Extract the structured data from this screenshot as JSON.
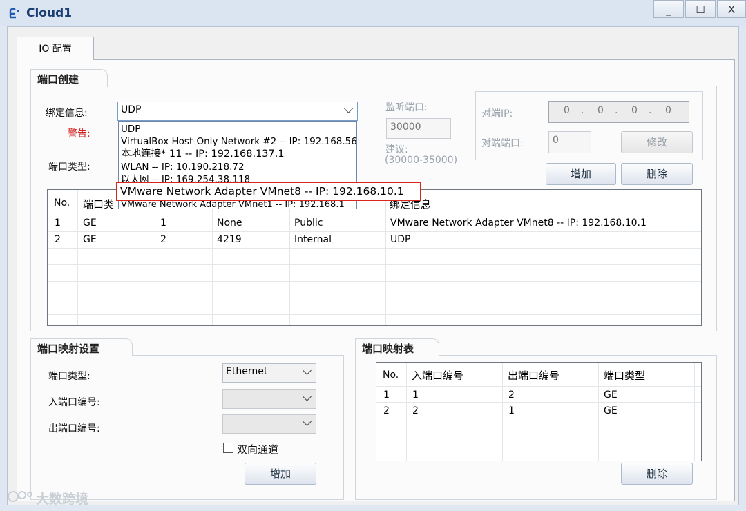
{
  "window": {
    "title": "Cloud1",
    "minimize_glyph": "_",
    "maximize_glyph": "☐",
    "close_glyph": "X"
  },
  "tab": {
    "label": "IO 配置"
  },
  "port_creation": {
    "title": "端口创建",
    "binding_label": "绑定信息:",
    "binding_value": "UDP",
    "warning_label": "警告:",
    "port_type_label": "端口类型:",
    "listen_port_label": "监听端口:",
    "listen_port_value": "30000",
    "suggest_label": "建议:",
    "suggest_range": "(30000-35000)",
    "peer_ip_label": "对端IP:",
    "peer_ip_octets": [
      "0",
      "0",
      "0",
      "0"
    ],
    "peer_port_label": "对端端口:",
    "peer_port_value": "0",
    "modify_button": "修改",
    "add_button": "增加",
    "delete_button": "删除"
  },
  "binding_dropdown": {
    "options": [
      "UDP",
      "VirtualBox Host-Only Network #2 -- IP: 192.168.56",
      "本地连接* 11 -- IP: 192.168.137.1",
      "WLAN -- IP: 10.190.218.72",
      "以太网 -- IP: 169.254.38.118",
      "VMware Network Adapter VMnet8 -- IP: 192.168.10.1",
      "VMware Network Adapter VMnet1 -- IP: 192.168.1"
    ],
    "highlighted": "VMware Network Adapter VMnet8 -- IP: 192.168.10.1"
  },
  "port_table": {
    "headers": [
      "No.",
      "端口类",
      "",
      "",
      "",
      "绑定信息"
    ],
    "rows": [
      [
        "1",
        "GE",
        "1",
        "None",
        "Public",
        "VMware Network Adapter VMnet8 -- IP: 192.168.10.1"
      ],
      [
        "2",
        "GE",
        "2",
        "4219",
        "Internal",
        "UDP"
      ]
    ]
  },
  "port_mapping_settings": {
    "title": "端口映射设置",
    "port_type_label": "端口类型:",
    "port_type_value": "Ethernet",
    "in_port_label": "入端口编号:",
    "out_port_label": "出端口编号:",
    "bidirectional_label": "双向通道",
    "add_button": "增加"
  },
  "port_mapping_table": {
    "title": "端口映射表",
    "headers": [
      "No.",
      "入端口编号",
      "出端口编号",
      "端口类型"
    ],
    "rows": [
      [
        "1",
        "1",
        "2",
        "GE"
      ],
      [
        "2",
        "2",
        "1",
        "GE"
      ]
    ],
    "delete_button": "删除"
  },
  "watermark": {
    "text": "大数跨境"
  }
}
